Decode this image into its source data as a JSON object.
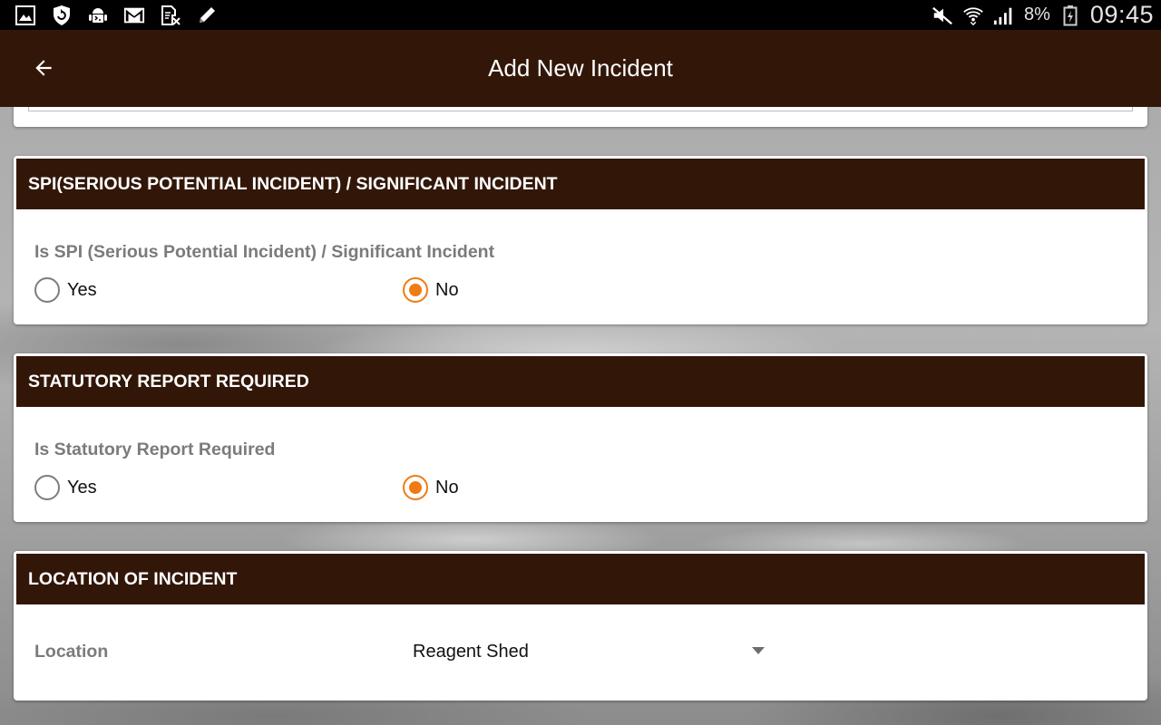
{
  "status_bar": {
    "icons": [
      "image-icon",
      "shield-refresh-icon",
      "android-debug-icon",
      "gmail-icon",
      "document-x-icon",
      "pencil-icon"
    ],
    "right_icons": [
      "mute-icon",
      "wifi-icon",
      "signal-icon",
      "battery-icon"
    ],
    "battery": "8%",
    "time": "09:45"
  },
  "app_bar": {
    "title": "Add New Incident",
    "back_icon": "arrow-left-icon",
    "color": "#321709"
  },
  "spi_section": {
    "header": "SPI(SERIOUS POTENTIAL INCIDENT) / SIGNIFICANT INCIDENT",
    "question": "Is SPI (Serious Potential Incident) / Significant Incident",
    "options": [
      {
        "label": "Yes",
        "selected": false
      },
      {
        "label": "No",
        "selected": true
      }
    ]
  },
  "statutory_section": {
    "header": "STATUTORY REPORT REQUIRED",
    "question": "Is Statutory Report Required",
    "options": [
      {
        "label": "Yes",
        "selected": false
      },
      {
        "label": "No",
        "selected": true
      }
    ]
  },
  "location_section": {
    "header": "LOCATION OF INCIDENT",
    "label": "Location",
    "selected_value": "Reagent Shed"
  },
  "colors": {
    "accent": "#f07b14",
    "header_bg": "#321709",
    "label_gray": "#7b7b7b"
  }
}
